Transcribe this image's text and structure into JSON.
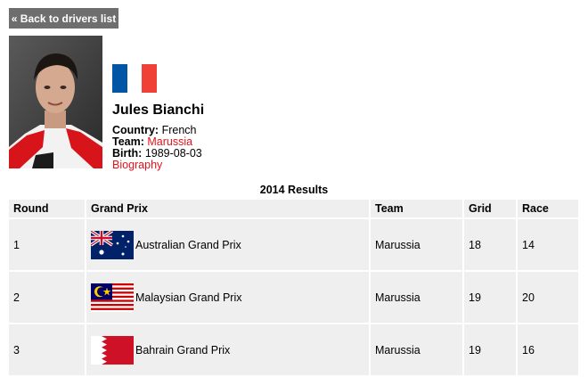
{
  "nav": {
    "back_label": "« Back to drivers list"
  },
  "driver": {
    "name": "Jules Bianchi",
    "flag_icon": "france-flag-icon",
    "country_label": "Country:",
    "country": "French",
    "team_label": "Team:",
    "team": "Marussia",
    "birth_label": "Birth:",
    "birth": "1989-08-03",
    "biography_link": "Biography"
  },
  "results": {
    "title": "2014 Results",
    "columns": [
      "Round",
      "Grand Prix",
      "Team",
      "Grid",
      "Race"
    ],
    "rows": [
      {
        "round": "1",
        "grand_prix": "Australian Grand Prix",
        "flag_icon": "australia-flag-icon",
        "team": "Marussia",
        "grid": "18",
        "race": "14"
      },
      {
        "round": "2",
        "grand_prix": "Malaysian Grand Prix",
        "flag_icon": "malaysia-flag-icon",
        "team": "Marussia",
        "grid": "19",
        "race": "20"
      },
      {
        "round": "3",
        "grand_prix": "Bahrain Grand Prix",
        "flag_icon": "bahrain-flag-icon",
        "team": "Marussia",
        "grid": "19",
        "race": "16"
      }
    ]
  },
  "colors": {
    "link_red": "#e4111b",
    "back_button_bg": "#6e6e6e",
    "table_cell_bg": "#efefef",
    "france_blue": "#0055a4",
    "france_red": "#ef4135"
  }
}
